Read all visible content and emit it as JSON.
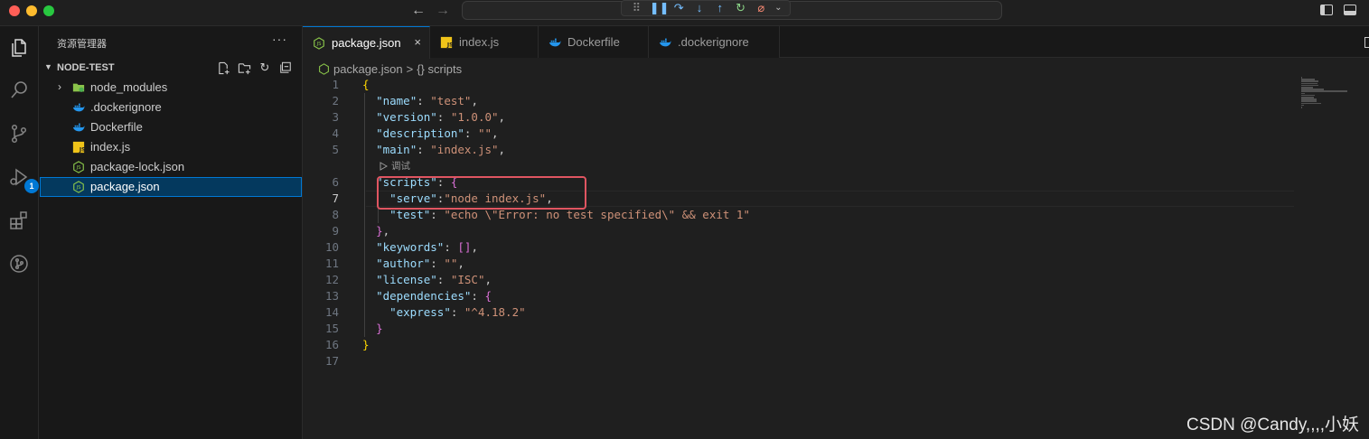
{
  "titlebar": {
    "nav_back_icon": "arrow-left-icon",
    "nav_forward_icon": "arrow-right-icon",
    "debug_toolbar": [
      "grip-icon",
      "pause-icon",
      "step-over-icon",
      "step-into-icon",
      "step-out-icon",
      "restart-icon",
      "disconnect-icon",
      "chevron-down-icon"
    ]
  },
  "activity_bar": {
    "items": [
      "explorer-icon",
      "search-icon",
      "source-control-icon",
      "run-debug-icon",
      "extensions-icon",
      "remote-icon"
    ],
    "debug_badge": "1"
  },
  "sidebar": {
    "title": "资源管理器",
    "more": "···",
    "section_title": "NODE-TEST",
    "items": [
      {
        "label": "node_modules",
        "kind": "folder",
        "collapsed": true
      },
      {
        "label": ".dockerignore",
        "kind": "docker"
      },
      {
        "label": "Dockerfile",
        "kind": "docker"
      },
      {
        "label": "index.js",
        "kind": "js"
      },
      {
        "label": "package-lock.json",
        "kind": "node"
      },
      {
        "label": "package.json",
        "kind": "node",
        "selected": true
      }
    ]
  },
  "tabs": [
    {
      "label": "package.json",
      "active": true,
      "close": "×"
    },
    {
      "label": "index.js"
    },
    {
      "label": "Dockerfile"
    },
    {
      "label": ".dockerignore"
    }
  ],
  "breadcrumbs": {
    "file": "package.json",
    "separator": ">",
    "symbol": "{} scripts"
  },
  "codelens": "调试",
  "code": {
    "current_line": 7,
    "lines": [
      {
        "n": "1",
        "parts": [
          [
            "b1",
            "{"
          ]
        ]
      },
      {
        "n": "2",
        "parts": [
          [
            "p",
            "  "
          ],
          [
            "k",
            "\"name\""
          ],
          [
            "p",
            ": "
          ],
          [
            "s",
            "\"test\""
          ],
          [
            "p",
            ","
          ]
        ]
      },
      {
        "n": "3",
        "parts": [
          [
            "p",
            "  "
          ],
          [
            "k",
            "\"version\""
          ],
          [
            "p",
            ": "
          ],
          [
            "s",
            "\"1.0.0\""
          ],
          [
            "p",
            ","
          ]
        ]
      },
      {
        "n": "4",
        "parts": [
          [
            "p",
            "  "
          ],
          [
            "k",
            "\"description\""
          ],
          [
            "p",
            ": "
          ],
          [
            "s",
            "\"\""
          ],
          [
            "p",
            ","
          ]
        ]
      },
      {
        "n": "5",
        "parts": [
          [
            "p",
            "  "
          ],
          [
            "k",
            "\"main\""
          ],
          [
            "p",
            ": "
          ],
          [
            "s",
            "\"index.js\""
          ],
          [
            "p",
            ","
          ]
        ]
      },
      {
        "n": "6",
        "parts": [
          [
            "p",
            "  "
          ],
          [
            "k",
            "\"scripts\""
          ],
          [
            "p",
            ": "
          ],
          [
            "b2",
            "{"
          ]
        ]
      },
      {
        "n": "7",
        "parts": [
          [
            "p",
            "    "
          ],
          [
            "k",
            "\"serve\""
          ],
          [
            "p",
            ":"
          ],
          [
            "s",
            "\"node index.js\""
          ],
          [
            "p",
            ","
          ]
        ]
      },
      {
        "n": "8",
        "parts": [
          [
            "p",
            "    "
          ],
          [
            "k",
            "\"test\""
          ],
          [
            "p",
            ": "
          ],
          [
            "s",
            "\"echo \\\"Error: no test specified\\\" && exit 1\""
          ]
        ]
      },
      {
        "n": "9",
        "parts": [
          [
            "p",
            "  "
          ],
          [
            "b2",
            "}"
          ],
          [
            "p",
            ","
          ]
        ]
      },
      {
        "n": "10",
        "parts": [
          [
            "p",
            "  "
          ],
          [
            "k",
            "\"keywords\""
          ],
          [
            "p",
            ": "
          ],
          [
            "b2",
            "[]"
          ],
          [
            "p",
            ","
          ]
        ]
      },
      {
        "n": "11",
        "parts": [
          [
            "p",
            "  "
          ],
          [
            "k",
            "\"author\""
          ],
          [
            "p",
            ": "
          ],
          [
            "s",
            "\"\""
          ],
          [
            "p",
            ","
          ]
        ]
      },
      {
        "n": "12",
        "parts": [
          [
            "p",
            "  "
          ],
          [
            "k",
            "\"license\""
          ],
          [
            "p",
            ": "
          ],
          [
            "s",
            "\"ISC\""
          ],
          [
            "p",
            ","
          ]
        ]
      },
      {
        "n": "13",
        "parts": [
          [
            "p",
            "  "
          ],
          [
            "k",
            "\"dependencies\""
          ],
          [
            "p",
            ": "
          ],
          [
            "b2",
            "{"
          ]
        ]
      },
      {
        "n": "14",
        "parts": [
          [
            "p",
            "    "
          ],
          [
            "k",
            "\"express\""
          ],
          [
            "p",
            ": "
          ],
          [
            "s",
            "\"^4.18.2\""
          ]
        ]
      },
      {
        "n": "15",
        "parts": [
          [
            "p",
            "  "
          ],
          [
            "b2",
            "}"
          ]
        ]
      },
      {
        "n": "16",
        "parts": [
          [
            "b1",
            "}"
          ]
        ]
      },
      {
        "n": "17",
        "parts": []
      }
    ]
  },
  "watermark": "CSDN @Candy,,,,小妖",
  "colors": {
    "accent": "#0078d4",
    "highlight_box": "#e05561",
    "json_key": "#9cdcfe",
    "json_string": "#ce9178"
  }
}
